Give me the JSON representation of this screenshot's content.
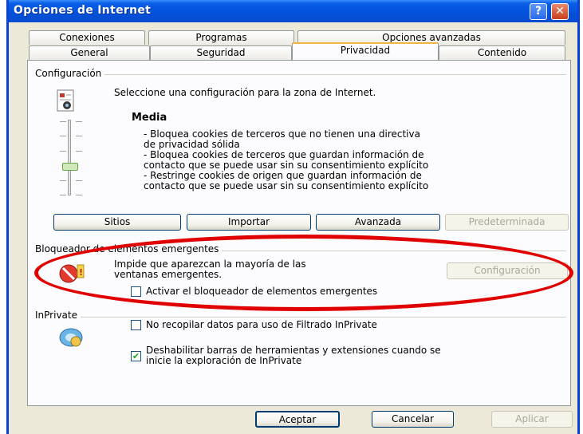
{
  "window": {
    "title": "Opciones de Internet",
    "help_glyph": "?",
    "close_glyph": "✕"
  },
  "tabs": {
    "row1": [
      "Conexiones",
      "Programas",
      "Opciones avanzadas"
    ],
    "row2": [
      "General",
      "Seguridad",
      "Privacidad",
      "Contenido"
    ],
    "active": "Privacidad"
  },
  "settings": {
    "group_label": "Configuración",
    "intro": "Seleccione una configuración para la zona de Internet.",
    "level": "Media",
    "description_lines": [
      "- Bloquea cookies de terceros que no tienen una directiva",
      "de privacidad sólida",
      "- Bloquea cookies de terceros que guardan información de",
      "contacto que se puede usar sin su consentimiento explícito",
      "- Restringe cookies de origen que guardan información de",
      "contacto que se  puede usar sin su consentimiento explícito"
    ],
    "buttons": {
      "sites": "Sitios",
      "import": "Importar",
      "advanced": "Avanzada",
      "default": "Predeterminada"
    }
  },
  "popup_blocker": {
    "group_label": "Bloqueador de elementos emergentes",
    "description_line1": "Impide que aparezcan la mayoría de las",
    "description_line2": "ventanas emergentes.",
    "settings_button": "Configuración",
    "enable_checkbox_label": "Activar el bloqueador de elementos emergentes",
    "enable_checked": false
  },
  "inprivate": {
    "group_label": "InPrivate",
    "no_collect_label": "No recopilar datos para uso de Filtrado InPrivate",
    "no_collect_checked": false,
    "disable_toolbars_line1": "Deshabilitar barras de herramientas y extensiones cuando se",
    "disable_toolbars_line2": "inicie la exploración de InPrivate",
    "disable_toolbars_checked": true
  },
  "footer": {
    "ok": "Aceptar",
    "cancel": "Cancelar",
    "apply": "Aplicar"
  },
  "colors": {
    "title_bar": "#0351d9",
    "highlight_ellipse": "#e00000",
    "dialog_bg": "#ece9d8"
  },
  "icons": [
    "help-icon",
    "close-icon",
    "privacy-page-icon",
    "popup-blocker-icon",
    "inprivate-icon",
    "checkmark-icon"
  ]
}
